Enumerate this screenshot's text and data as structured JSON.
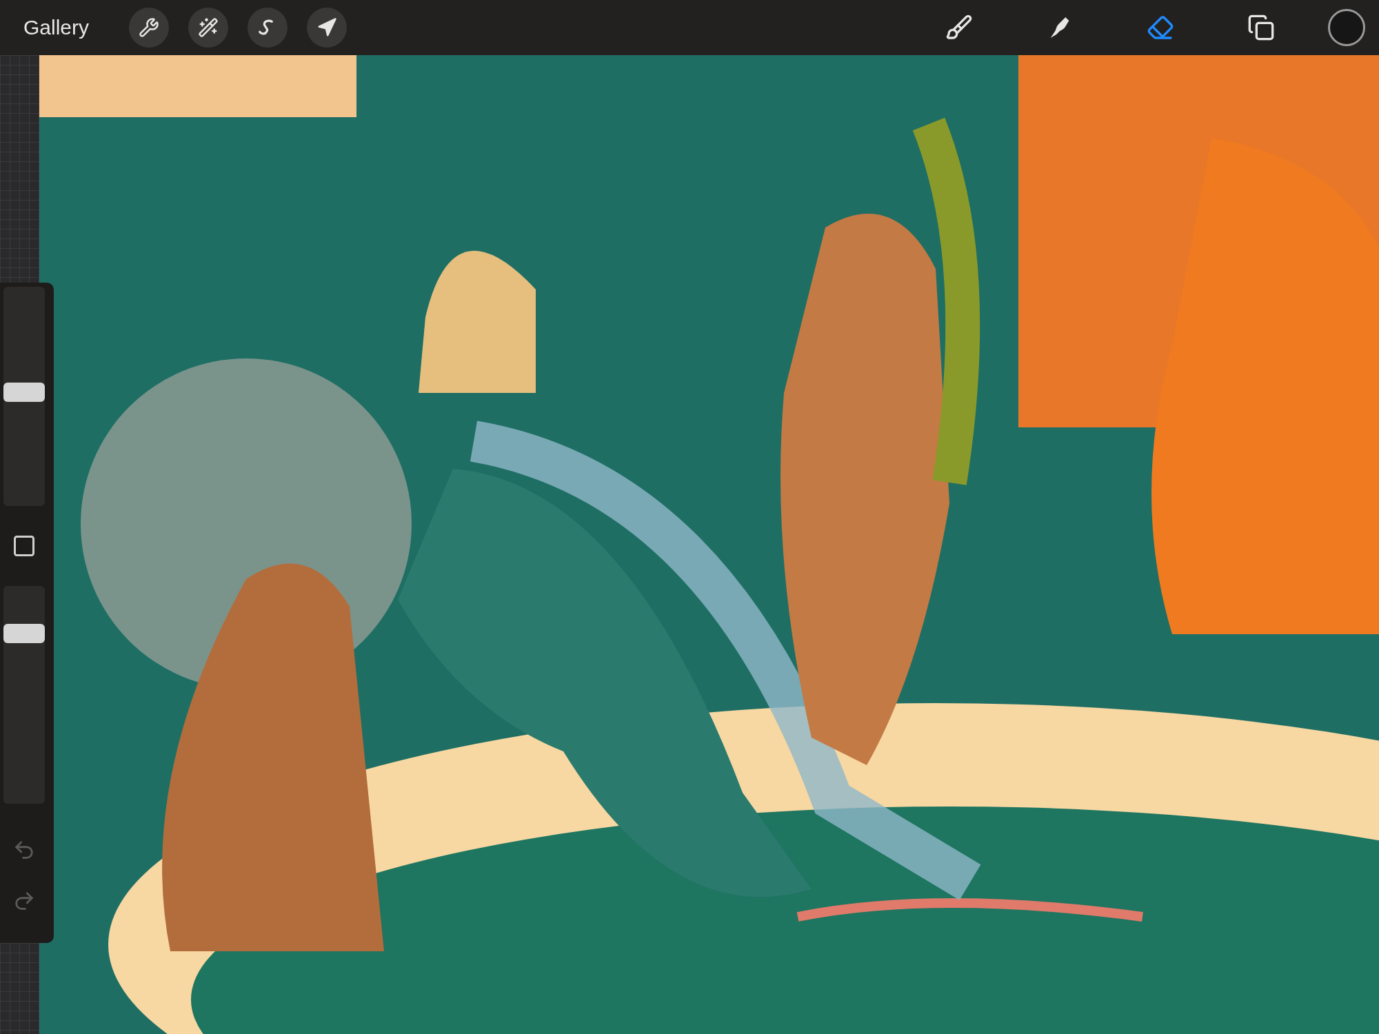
{
  "top_bar": {
    "gallery": "Gallery",
    "tools": [
      {
        "kind": "brush",
        "selected": false
      },
      {
        "kind": "smudge",
        "selected": false
      },
      {
        "kind": "eraser",
        "selected": true
      }
    ]
  },
  "sidebar": {
    "sliders": [
      {
        "kind": "size",
        "level": 0.52
      },
      {
        "kind": "opacity",
        "level": 0.81
      }
    ]
  }
}
